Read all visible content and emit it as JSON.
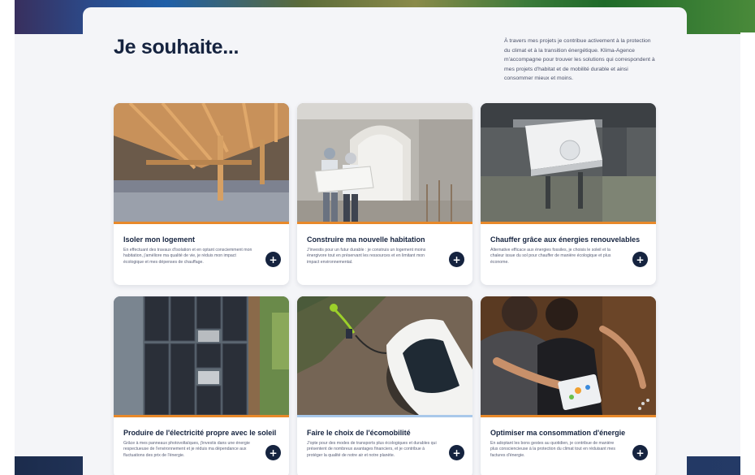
{
  "page": {
    "title": "Je souhaite...",
    "intro": "À travers mes projets je contribue activement à la protection du climat et à la transition énergétique. Klima-Agence m'accompagne pour trouver les solutions qui correspondent à mes projets d'habitat et de mobilité durable et ainsi consommer mieux et moins."
  },
  "colors": {
    "navy": "#15233f",
    "accent_orange": "#e8892a",
    "accent_blue": "#a9c8ea",
    "background": "#f4f5f8"
  },
  "cards": [
    {
      "title": "Isoler mon logement",
      "text": "En effectuant des travaux d'isolation et en optant consciemment mon habitation, j'améliore ma qualité de vie, je réduis mon impact écologique et mes dépenses de chauffage.",
      "button_icon": "plus-icon",
      "button_label": "+"
    },
    {
      "title": "Construire ma nouvelle habitation",
      "text": "J'investis pour un futur durable : je construis un logement moins énergivore tout en préservant les ressources et en limitant mon impact environnemental.",
      "button_icon": "plus-icon",
      "button_label": "+"
    },
    {
      "title": "Chauffer grâce aux énergies renouvelables",
      "text": "Alternative efficace aux énergies fossiles, je choisis le soleil et la chaleur issue du sol pour chauffer de manière écologique et plus économe.",
      "button_icon": "plus-icon",
      "button_label": "+"
    },
    {
      "title": "Produire de l'électricité propre avec le soleil",
      "text": "Grâce à mes panneaux photovoltaïques, j'investis dans une énergie respectueuse de l'environnement et je réduis ma dépendance aux fluctuations des prix de l'énergie.",
      "button_icon": "plus-icon",
      "button_label": "+"
    },
    {
      "title": "Faire le choix de l'écomobilité",
      "text": "J'opte pour des modes de transports plus écologiques et durables qui présentent de nombreux avantages financiers, et je contribue à protéger la qualité de notre air et notre planète.",
      "button_icon": "plus-icon",
      "button_label": "+"
    },
    {
      "title": "Optimiser ma consommation d'énergie",
      "text": "En adoptant les bons gestes au quotidien, je contribue de manière plus consciencieuse à la protection du climat tout en réduisant mes factures d'énergie.",
      "button_icon": "plus-icon",
      "button_label": "+"
    }
  ]
}
